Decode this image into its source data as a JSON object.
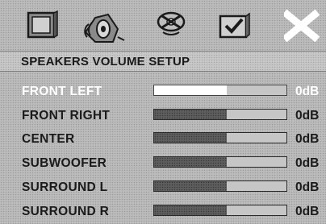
{
  "menu_icons": [
    {
      "name": "general-setup",
      "icon": "monitor-icon"
    },
    {
      "name": "audio-setup",
      "icon": "speaker-icon"
    },
    {
      "name": "video-setup",
      "icon": "disc-icon"
    },
    {
      "name": "preferences",
      "icon": "checkmark-icon"
    },
    {
      "name": "exit",
      "icon": "close-icon"
    }
  ],
  "title": "SPEAKERS VOLUME SETUP",
  "rows": [
    {
      "label": "FRONT LEFT",
      "value": "0dB",
      "level": 0.55,
      "selected": true
    },
    {
      "label": "FRONT RIGHT",
      "value": "0dB",
      "level": 0.55,
      "selected": false
    },
    {
      "label": "CENTER",
      "value": "0dB",
      "level": 0.55,
      "selected": false
    },
    {
      "label": "SUBWOOFER",
      "value": "0dB",
      "level": 0.55,
      "selected": false
    },
    {
      "label": "SURROUND L",
      "value": "0dB",
      "level": 0.55,
      "selected": false
    },
    {
      "label": "SURROUND R",
      "value": "0dB",
      "level": 0.55,
      "selected": false
    }
  ],
  "colors": {
    "selected_text": "#ffffff",
    "normal_text": "#1a1a1a",
    "bar_fill": "#5e5e5e"
  }
}
